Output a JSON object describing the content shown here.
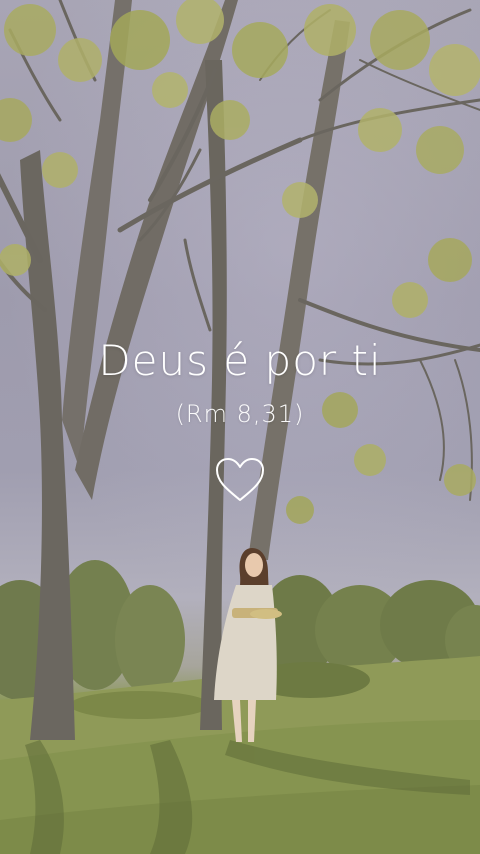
{
  "overlay": {
    "headline": "Deus é por ti",
    "reference": "(Rm 8,31)",
    "icon": "heart-outline-icon"
  },
  "colors": {
    "text": "#ffffff",
    "sky": "#a09eb0",
    "grass": "#8a9656",
    "foliage": "#a3a85a",
    "trunk": "#6f6b63",
    "dress": "#ddd6c8"
  }
}
